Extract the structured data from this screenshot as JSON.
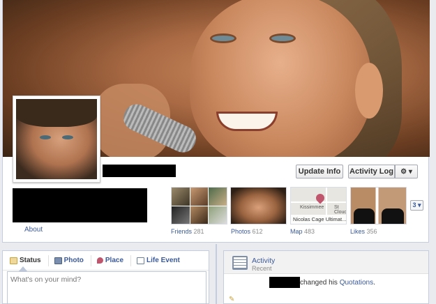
{
  "header": {
    "update_info_label": "Update Info",
    "activity_log_label": "Activity Log",
    "gear_label": "⚙ ▾"
  },
  "about": {
    "label": "About"
  },
  "apps": [
    {
      "label": "Friends",
      "count": "281"
    },
    {
      "label": "Photos",
      "count": "612"
    },
    {
      "label": "Map",
      "count": "483"
    },
    {
      "label": "Likes",
      "count": "356"
    }
  ],
  "map": {
    "place1": "Kissimmee",
    "place2": "St Cloud",
    "caption": "Nicolas Cage Ultimat..."
  },
  "more_button": "3 ▾",
  "composer": {
    "tabs": [
      {
        "label": "Status",
        "icon": "status-icon"
      },
      {
        "label": "Photo",
        "icon": "photo-icon"
      },
      {
        "label": "Place",
        "icon": "place-icon"
      },
      {
        "label": "Life Event",
        "icon": "life-event-icon"
      }
    ],
    "placeholder": "What's on your mind?"
  },
  "activity": {
    "title": "Activity",
    "subtitle": "Recent",
    "story_text": "changed his",
    "story_link": "Quotations",
    "story_end": "."
  },
  "colors": {
    "link": "#3b5998",
    "page_bg": "#e9ebee",
    "border": "#c4cde0"
  }
}
